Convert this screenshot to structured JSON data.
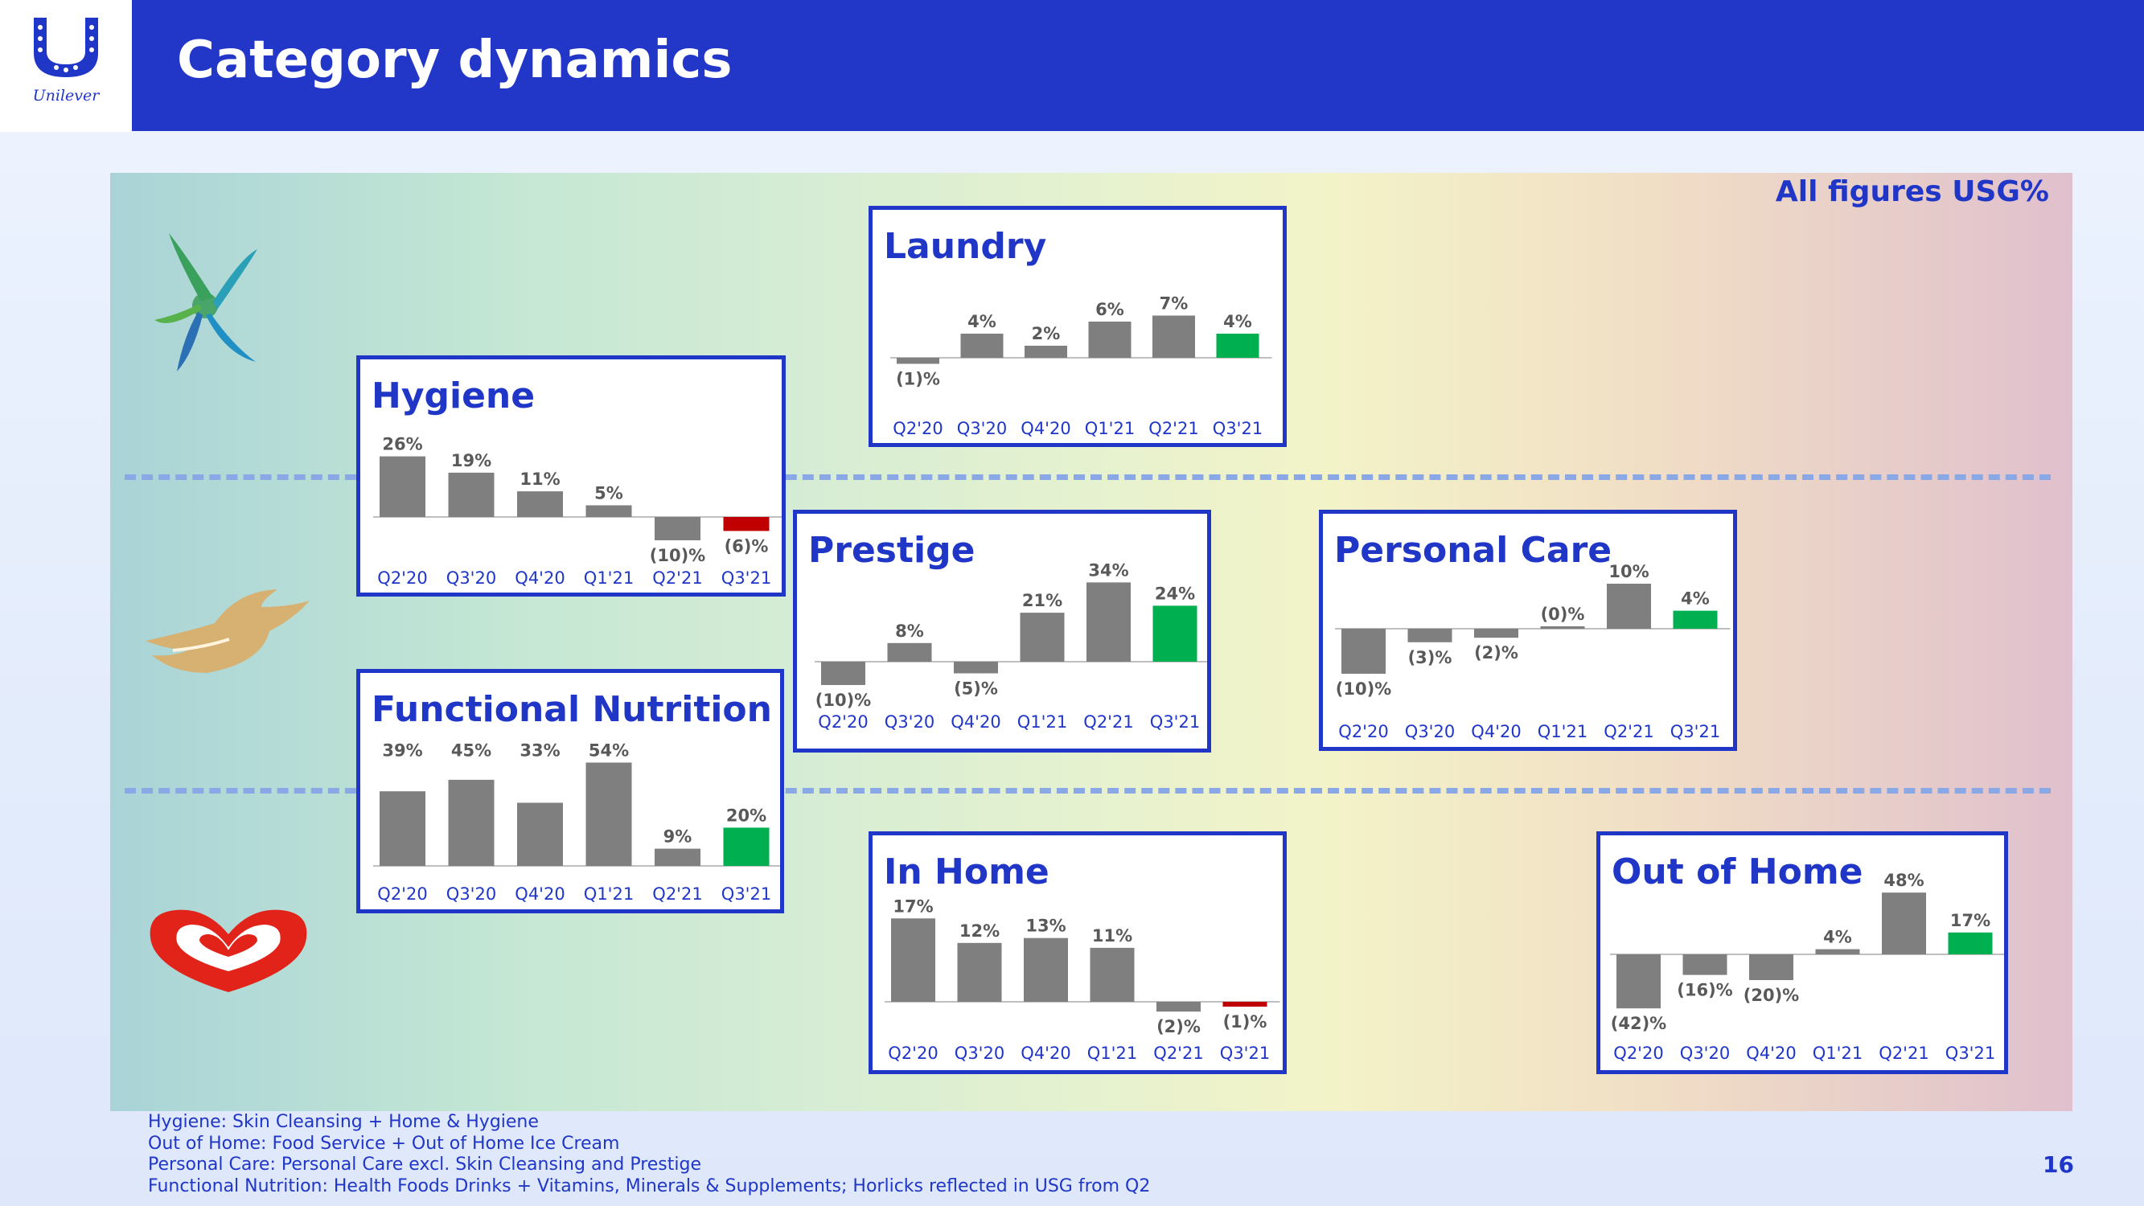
{
  "header": {
    "logo_text": "Unilever",
    "title": "Category dynamics",
    "figures_note": "All figures USG%"
  },
  "colors": {
    "brand_blue": "#1f36c7",
    "bar_grey": "#7f7f7f",
    "positive_latest": "#00b050",
    "negative_latest": "#c00000",
    "dashes": "#8aa8e6"
  },
  "brand_icons": [
    "beauty-personal-care-icon",
    "dove-bird-icon",
    "heart-brand-icon"
  ],
  "chart_data": [
    {
      "type": "bar",
      "title": "Laundry",
      "categories": [
        "Q2'20",
        "Q3'20",
        "Q4'20",
        "Q1'21",
        "Q2'21",
        "Q3'21"
      ],
      "values": [
        -1,
        4,
        2,
        6,
        7,
        4
      ],
      "labels": [
        "(1)%",
        "4%",
        "2%",
        "6%",
        "7%",
        "4%"
      ],
      "ylim": [
        -1,
        7
      ]
    },
    {
      "type": "bar",
      "title": "Hygiene",
      "categories": [
        "Q2'20",
        "Q3'20",
        "Q4'20",
        "Q1'21",
        "Q2'21",
        "Q3'21"
      ],
      "values": [
        26,
        19,
        11,
        5,
        -10,
        -6
      ],
      "labels": [
        "26%",
        "19%",
        "11%",
        "5%",
        "(10)%",
        "(6)%"
      ],
      "ylim": [
        -10,
        26
      ]
    },
    {
      "type": "bar",
      "title": "Prestige",
      "categories": [
        "Q2'20",
        "Q3'20",
        "Q4'20",
        "Q1'21",
        "Q2'21",
        "Q3'21"
      ],
      "values": [
        -10,
        8,
        -5,
        21,
        34,
        24
      ],
      "labels": [
        "(10)%",
        "8%",
        "(5)%",
        "21%",
        "34%",
        "24%"
      ],
      "ylim": [
        -10,
        34
      ]
    },
    {
      "type": "bar",
      "title": "Personal Care",
      "categories": [
        "Q2'20",
        "Q3'20",
        "Q4'20",
        "Q1'21",
        "Q2'21",
        "Q3'21"
      ],
      "values": [
        -10,
        -3,
        -2,
        0,
        10,
        4
      ],
      "labels": [
        "(10)%",
        "(3)%",
        "(2)%",
        "(0)%",
        "10%",
        "4%"
      ],
      "ylim": [
        -10,
        10
      ]
    },
    {
      "type": "bar",
      "title": "Functional Nutrition",
      "categories": [
        "Q2'20",
        "Q3'20",
        "Q4'20",
        "Q1'21",
        "Q2'21",
        "Q3'21"
      ],
      "values": [
        39,
        45,
        33,
        54,
        9,
        20
      ],
      "labels": [
        "39%",
        "45%",
        "33%",
        "54%",
        "9%",
        "20%"
      ],
      "ylim": [
        0,
        54
      ]
    },
    {
      "type": "bar",
      "title": "In Home",
      "categories": [
        "Q2'20",
        "Q3'20",
        "Q4'20",
        "Q1'21",
        "Q2'21",
        "Q3'21"
      ],
      "values": [
        17,
        12,
        13,
        11,
        -2,
        -1
      ],
      "labels": [
        "17%",
        "12%",
        "13%",
        "11%",
        "(2)%",
        "(1)%"
      ],
      "ylim": [
        -2,
        17
      ]
    },
    {
      "type": "bar",
      "title": "Out of Home",
      "categories": [
        "Q2'20",
        "Q3'20",
        "Q4'20",
        "Q1'21",
        "Q2'21",
        "Q3'21"
      ],
      "values": [
        -42,
        -16,
        -20,
        4,
        48,
        17
      ],
      "labels": [
        "(42)%",
        "(16)%",
        "(20)%",
        "4%",
        "48%",
        "17%"
      ],
      "ylim": [
        -42,
        48
      ]
    }
  ],
  "footnotes": [
    "Hygiene: Skin Cleansing + Home & Hygiene",
    "Out of Home: Food Service + Out of Home Ice Cream",
    "Personal Care: Personal Care excl. Skin Cleansing and Prestige",
    "Functional Nutrition: Health Foods Drinks + Vitamins, Minerals & Supplements; Horlicks reflected in USG from Q2"
  ],
  "page_number": "16"
}
